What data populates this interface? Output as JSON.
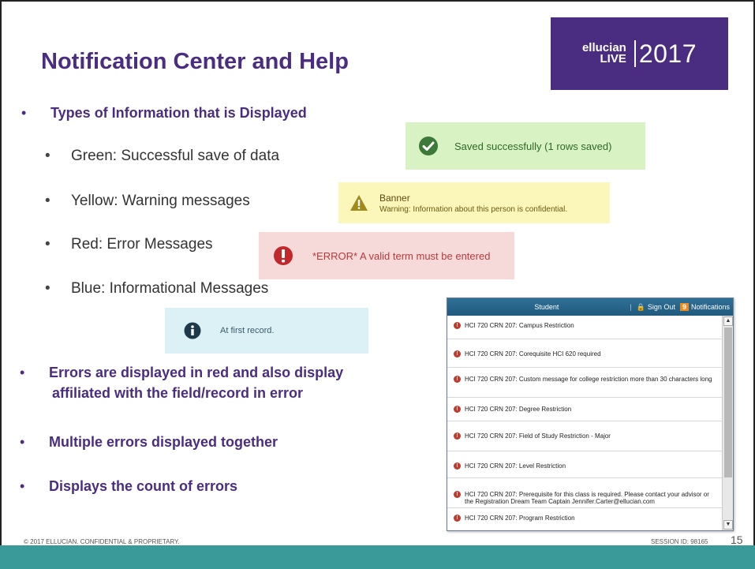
{
  "slide": {
    "title": "Notification Center and Help",
    "logo": {
      "brand_top": "ellucian",
      "brand_bottom": "LIVE",
      "year": "2017"
    },
    "heading_bullets": [
      "Types of Information that is Displayed",
      "Errors are displayed in red and also display",
      "affiliated with the field/record in error",
      "Multiple errors displayed together",
      "Displays the count of errors"
    ],
    "sub_bullets": [
      "Green: Successful save of data",
      "Yellow: Warning messages",
      "Red: Error Messages",
      "Blue: Informational Messages"
    ],
    "samples": {
      "green": "Saved successfully (1 rows saved)",
      "yellow_title": "Banner",
      "yellow_body": "Warning: Information about this person is confidential.",
      "red": "*ERROR* A valid term must be entered",
      "blue": "At first record."
    },
    "panel": {
      "student_label": "Student",
      "sign_out": "Sign Out",
      "count": "9",
      "notifications_label": "Notifications",
      "items": [
        "HCI 720 CRN 207: Campus Restriction",
        "HCI 720 CRN 207: Corequisite HCI 620 required",
        "HCI 720 CRN 207: Custom message for college restriction more than 30 characters long",
        "HCI 720 CRN 207: Degree Restriction",
        "HCI 720 CRN 207: Field of Study Restriction - Major",
        "HCI 720 CRN 207: Level Restriction",
        "HCI 720 CRN 207: Prerequisite for this class is required. Please contact your advisor or the Registration Dream Team Captain Jennifer.Carter@ellucian.com",
        "HCI 720 CRN 207: Program Restriction"
      ]
    },
    "footer": {
      "copyright": "© 2017 ELLUCIAN. CONFIDENTIAL & PROPRIETARY.",
      "session": "SESSION ID: 98165",
      "page_number": "15"
    },
    "colors": {
      "purple": "#4a2d80",
      "teal_bar": "#3a9a9a",
      "orange_badge": "#f08a1c"
    }
  }
}
